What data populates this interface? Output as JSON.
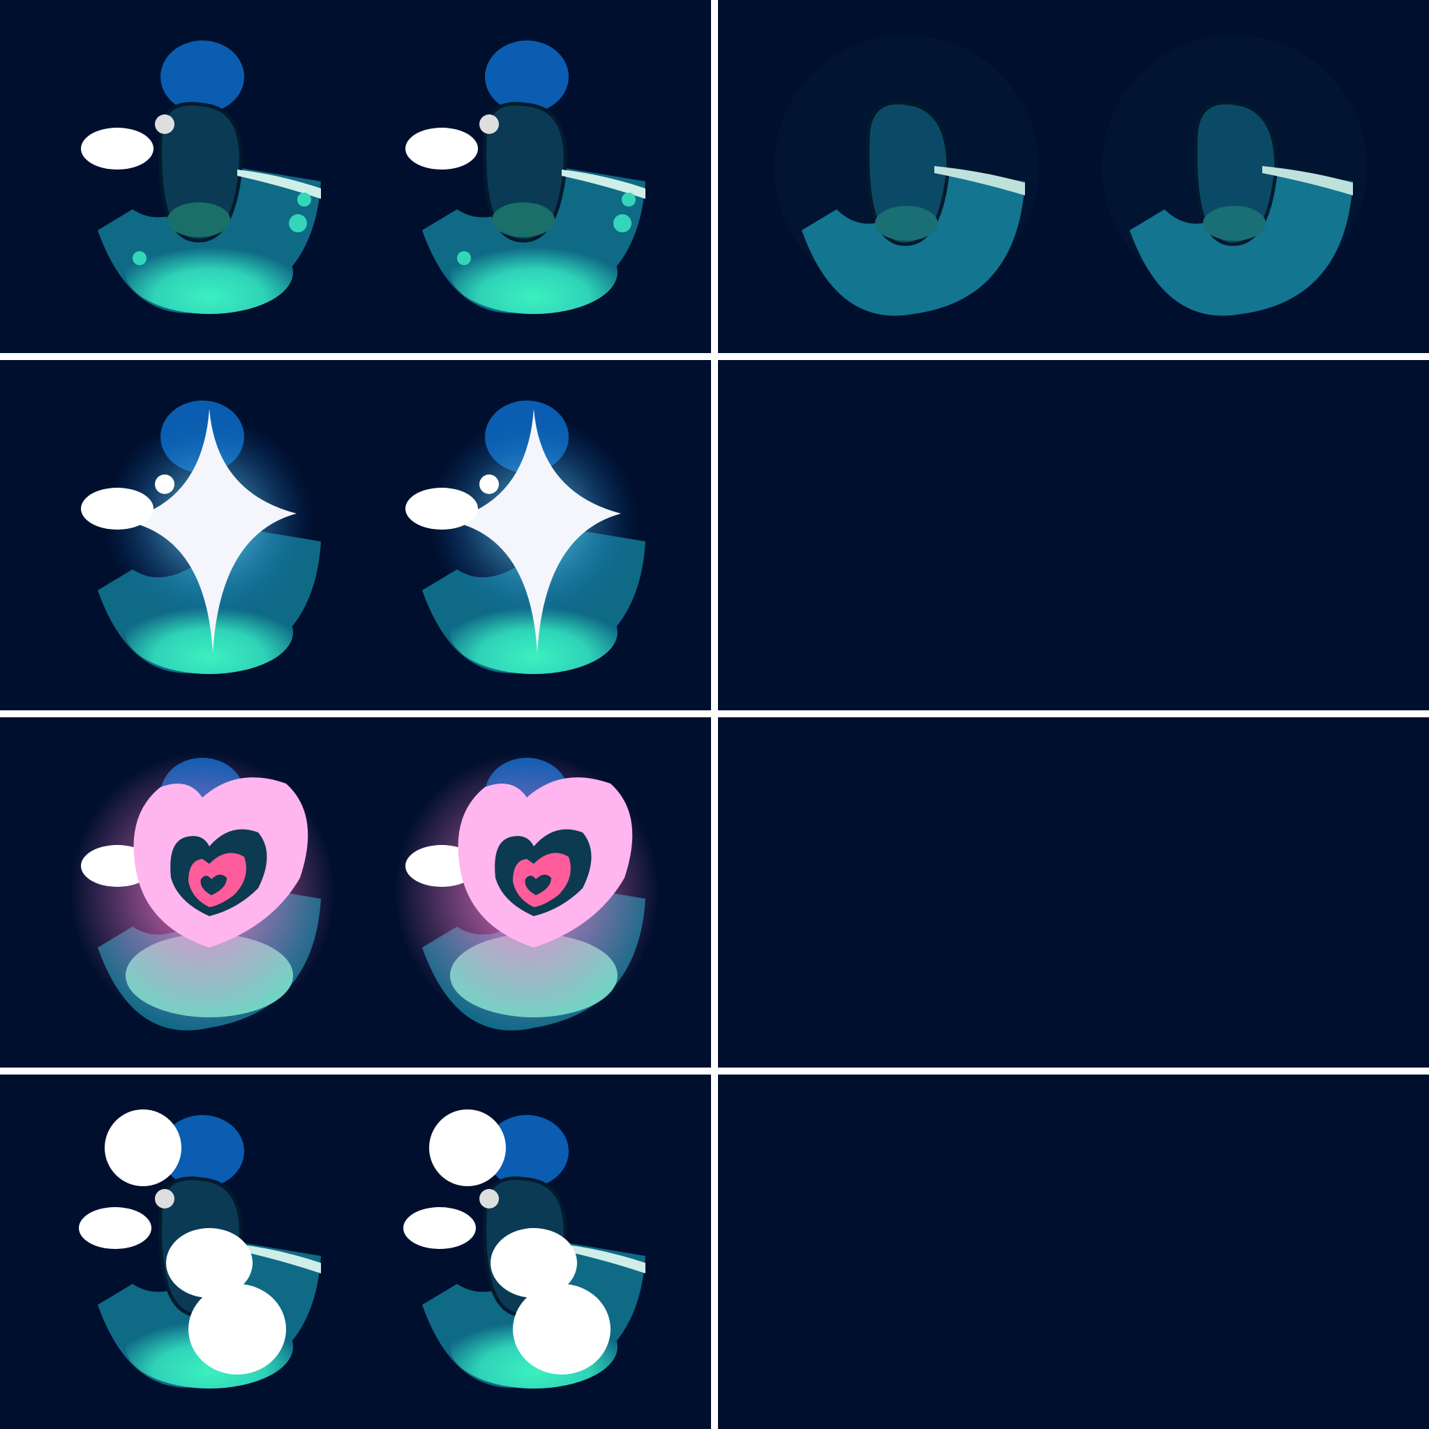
{
  "sheet": {
    "description_visible_text": "",
    "colors": {
      "background": "#000f2e",
      "divider": "#ffffff",
      "iris_teal": "#0f6a86",
      "iris_glow": "#3cf0c0",
      "pupil": "#0b3a55",
      "top_blue": "#0a5db0",
      "highlight": "#ffffff",
      "heart_pink": "#ffb6ee",
      "heart_inner": "#ff5c9c"
    },
    "panels": [
      {
        "id": "normal",
        "variant": "normal"
      },
      {
        "id": "dim",
        "variant": "dim"
      },
      {
        "id": "sparkle",
        "variant": "sparkle"
      },
      {
        "id": "empty-1",
        "variant": "empty"
      },
      {
        "id": "heart",
        "variant": "heart"
      },
      {
        "id": "empty-2",
        "variant": "empty"
      },
      {
        "id": "big-shine",
        "variant": "big-shine"
      },
      {
        "id": "empty-3",
        "variant": "empty"
      }
    ]
  }
}
